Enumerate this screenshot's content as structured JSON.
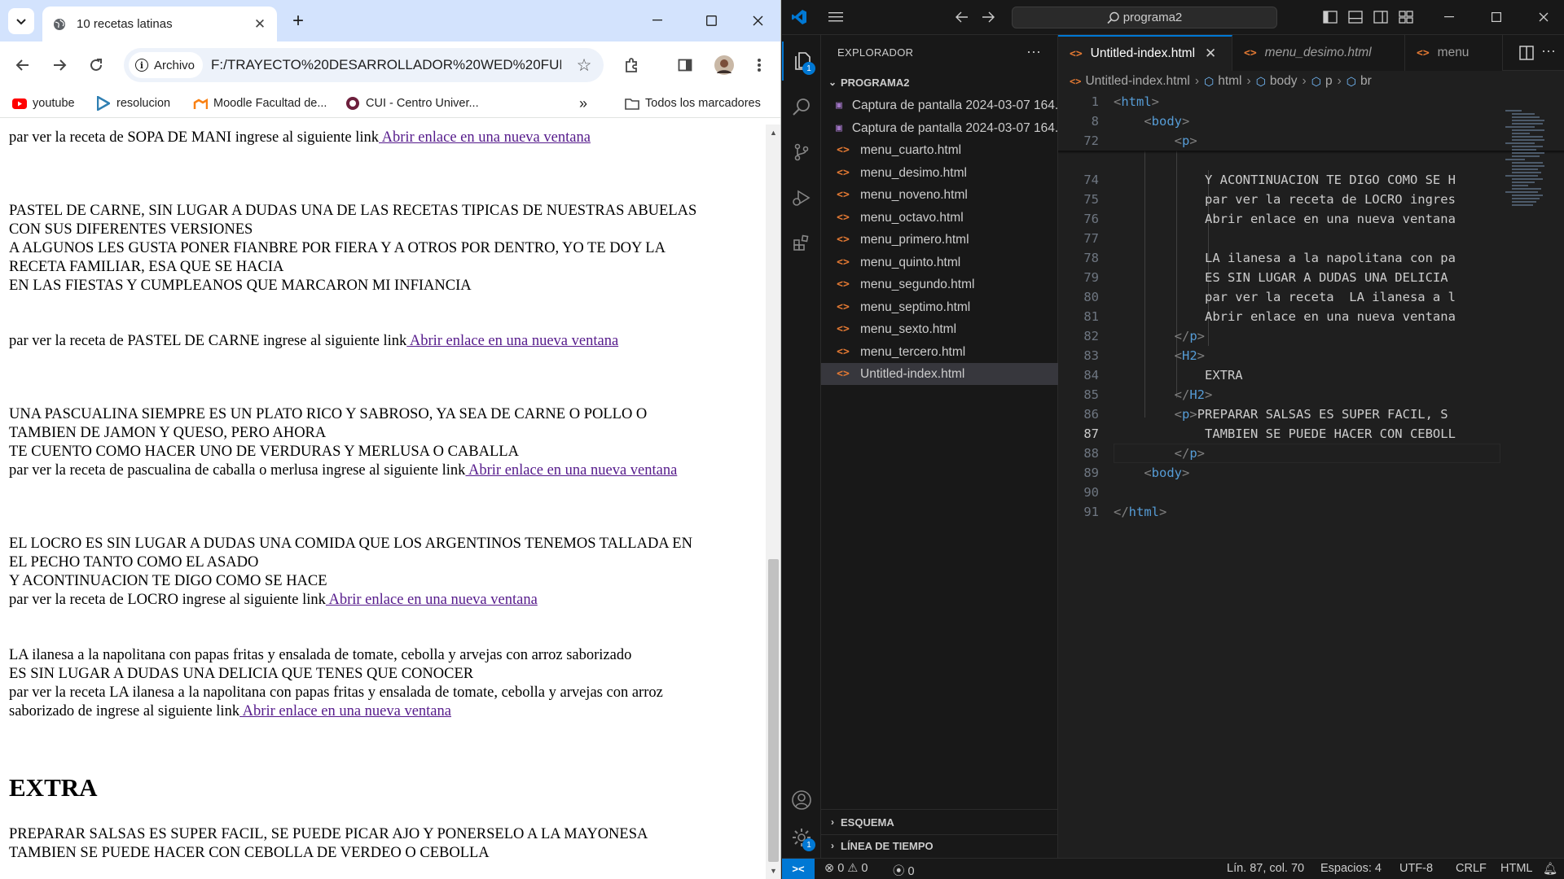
{
  "browser": {
    "tab": {
      "title": "10 recetas latinas"
    },
    "address": {
      "security_label": "Archivo",
      "url": "F:/TRAYECTO%20DESARROLLADOR%20WED%20FULL..."
    },
    "bookmarks": [
      {
        "label": "youtube",
        "icon": "youtube-icon"
      },
      {
        "label": "resolucion",
        "icon": "play-icon"
      },
      {
        "label": "Moodle Facultad de...",
        "icon": "moodle-icon"
      },
      {
        "label": "CUI - Centro Univer...",
        "icon": "cui-icon"
      }
    ],
    "bookmarks_overflow": "»",
    "all_bookmarks_label": "Todos los marcadores",
    "page": {
      "sopa_line": "par ver la receta de SOPA DE MANI ingrese al siguiente link",
      "link_text": " Abrir enlace en una nueva ventana",
      "pastel_desc": [
        "PASTEL DE CARNE, SIN LUGAR A DUDAS UNA DE LAS RECETAS TIPICAS DE NUESTRAS ABUELAS",
        "CON SUS DIFERENTES VERSIONES",
        "A ALGUNOS LES GUSTA PONER FIANBRE POR FIERA Y A OTROS POR DENTRO, YO TE DOY LA",
        "RECETA FAMILIAR, ESA QUE SE HACIA",
        "EN LAS FIESTAS Y CUMPLEANOS QUE MARCARON MI INFIANCIA"
      ],
      "pastel_line": "par ver la receta de PASTEL DE CARNE ingrese al siguiente link",
      "pascualina_desc": [
        "UNA PASCUALINA SIEMPRE ES UN PLATO RICO Y SABROSO, YA SEA DE CARNE O POLLO O",
        "TAMBIEN DE JAMON Y QUESO, PERO AHORA",
        "TE CUENTO COMO HACER UNO DE VERDURAS Y MERLUSA O CABALLA"
      ],
      "pascualina_line": "par ver la receta de pascualina de caballa o merlusa ingrese al siguiente link",
      "locro_desc": [
        "EL LOCRO ES SIN LUGAR A DUDAS UNA COMIDA QUE LOS ARGENTINOS TENEMOS TALLADA EN",
        "EL PECHO TANTO COMO EL ASADO",
        "Y ACONTINUACION TE DIGO COMO SE HACE"
      ],
      "locro_line": "par ver la receta de LOCRO ingrese al siguiente link",
      "milanesa_desc": [
        "LA ilanesa a la napolitana con papas fritas y ensalada de tomate, cebolla y arvejas con arroz saborizado",
        "ES SIN LUGAR A DUDAS UNA DELICIA QUE TENES QUE CONOCER",
        "par ver la receta LA ilanesa a la napolitana con papas fritas y ensalada de tomate, cebolla y arvejas con arroz"
      ],
      "milanesa_line": "saborizado de ingrese al siguiente link",
      "extra_heading": "EXTRA",
      "extra_text": [
        "PREPARAR SALSAS ES SUPER FACIL, SE PUEDE PICAR AJO Y PONERSELO A LA MAYONESA",
        "TAMBIEN SE PUEDE HACER CON CEBOLLA DE VERDEO O CEBOLLA"
      ]
    }
  },
  "vscode": {
    "search_text": "programa2",
    "explorer_title": "EXPLORADOR",
    "folder_name": "PROGRAMA2",
    "files": [
      {
        "name": "Captura de pantalla 2024-03-07 164...",
        "type": "image"
      },
      {
        "name": "Captura de pantalla 2024-03-07 164...",
        "type": "image"
      },
      {
        "name": "menu_cuarto.html",
        "type": "html"
      },
      {
        "name": "menu_desimo.html",
        "type": "html"
      },
      {
        "name": "menu_noveno.html",
        "type": "html"
      },
      {
        "name": "menu_octavo.html",
        "type": "html"
      },
      {
        "name": "menu_primero.html",
        "type": "html"
      },
      {
        "name": "menu_quinto.html",
        "type": "html"
      },
      {
        "name": "menu_segundo.html",
        "type": "html"
      },
      {
        "name": "menu_septimo.html",
        "type": "html"
      },
      {
        "name": "menu_sexto.html",
        "type": "html"
      },
      {
        "name": "menu_tercero.html",
        "type": "html"
      },
      {
        "name": "Untitled-index.html",
        "type": "html",
        "selected": true
      }
    ],
    "outline_label": "ESQUEMA",
    "timeline_label": "LÍNEA DE TIEMPO",
    "activity_badge_explorer": "1",
    "activity_badge_settings": "1",
    "editor_tabs": [
      {
        "label": "Untitled-index.html",
        "active": true
      },
      {
        "label": "menu_desimo.html",
        "active": false
      },
      {
        "label": "menu",
        "active": false
      }
    ],
    "breadcrumb": [
      "Untitled-index.html",
      "html",
      "body",
      "p",
      "br"
    ],
    "sticky_lines": [
      {
        "num": "1",
        "code": "<html>"
      },
      {
        "num": "8",
        "code": "    <body>"
      },
      {
        "num": "72",
        "code": "        <p>"
      }
    ],
    "code_lines": [
      {
        "num": "74",
        "code": "            Y ACONTINUACION TE DIGO COMO SE H"
      },
      {
        "num": "75",
        "code": "            par ver la receta de LOCRO ingres"
      },
      {
        "num": "76",
        "code": "            Abrir enlace en una nueva ventana"
      },
      {
        "num": "77",
        "code": ""
      },
      {
        "num": "78",
        "code": "            LA ilanesa a la napolitana con pa"
      },
      {
        "num": "79",
        "code": "            ES SIN LUGAR A DUDAS UNA DELICIA "
      },
      {
        "num": "80",
        "code": "            par ver la receta  LA ilanesa a l"
      },
      {
        "num": "81",
        "code": "            Abrir enlace en una nueva ventana"
      },
      {
        "num": "82",
        "code": "        </p>"
      },
      {
        "num": "83",
        "code": "        <H2>"
      },
      {
        "num": "84",
        "code": "            EXTRA"
      },
      {
        "num": "85",
        "code": "        </H2>"
      },
      {
        "num": "86",
        "code": "        <p>PREPARAR SALSAS ES SUPER FACIL, S"
      },
      {
        "num": "87",
        "code": "            TAMBIEN SE PUEDE HACER CON CEBOLL"
      },
      {
        "num": "88",
        "code": "        </p>"
      },
      {
        "num": "89",
        "code": "    <body>"
      },
      {
        "num": "90",
        "code": ""
      },
      {
        "num": "91",
        "code": "</html>"
      }
    ],
    "status": {
      "errors": "0",
      "warnings": "0",
      "ports": "0",
      "position": "Lín. 87, col. 70",
      "spaces": "Espacios: 4",
      "encoding": "UTF-8",
      "eol": "CRLF",
      "language": "HTML"
    }
  }
}
